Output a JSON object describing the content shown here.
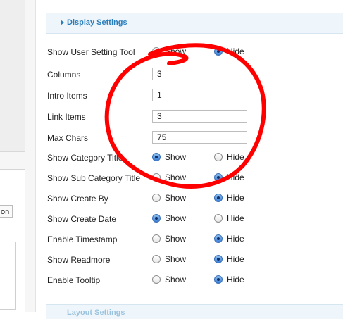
{
  "left": {
    "button_fragment": "on"
  },
  "section": {
    "title": "Display Settings"
  },
  "footer": {
    "title": "Layout Settings"
  },
  "text_fields": [
    {
      "label": "Columns",
      "value": "3"
    },
    {
      "label": "Intro Items",
      "value": "1"
    },
    {
      "label": "Link Items",
      "value": "3"
    },
    {
      "label": "Max Chars",
      "value": "75"
    }
  ],
  "radio_labels": {
    "show": "Show",
    "hide": "Hide"
  },
  "radio_settings": [
    {
      "label": "Show User Setting Tool",
      "selected": "Hide"
    },
    {
      "label": "Show Category Title",
      "selected": "Show"
    },
    {
      "label": "Show Sub Category Title",
      "selected": "Hide"
    },
    {
      "label": "Show Create By",
      "selected": "Hide"
    },
    {
      "label": "Show Create Date",
      "selected": "Show"
    },
    {
      "label": "Enable Timestamp",
      "selected": "Hide"
    },
    {
      "label": "Show Readmore",
      "selected": "Hide"
    },
    {
      "label": "Enable Tooltip",
      "selected": "Hide"
    }
  ],
  "annotation": {
    "color": "#ff0000"
  }
}
